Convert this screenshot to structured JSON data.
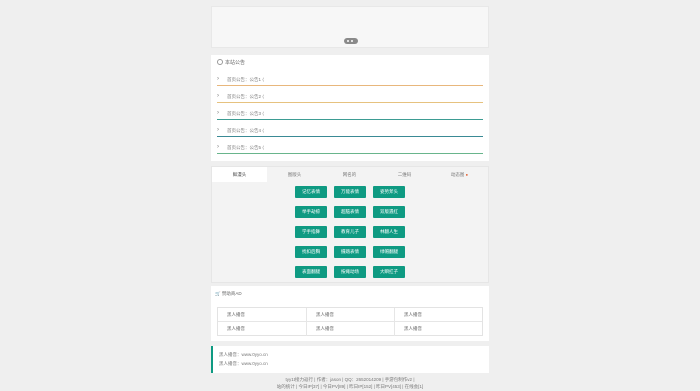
{
  "notice": {
    "title": "本站公告",
    "items": [
      {
        "text": "首页公告：公告1 ⟨",
        "color": "#e8b77c"
      },
      {
        "text": "首页公告：公告2 ⟨",
        "color": "#e6c27f"
      },
      {
        "text": "首页公告：公告3 ⟨",
        "color": "#3d9c93"
      },
      {
        "text": "首页公告：公告4 ⟨",
        "color": "#3a8a95"
      },
      {
        "text": "首页公告：公告5 ⟨",
        "color": "#69b58c"
      }
    ]
  },
  "tabs": [
    "鲜漫头",
    "图版头",
    "网名的",
    "二维码",
    "动态图"
  ],
  "tab_hot_mark": "●",
  "buttons": [
    [
      "记忆表情",
      "万能表情",
      "姿势斧头"
    ],
    [
      "举手劫掠",
      "超脑表情",
      "双版遇红"
    ],
    [
      "学手指舞",
      "教育儿子",
      "林翻人生"
    ],
    [
      "找扣后胸",
      "摄踏表情",
      "绿帽翻腿"
    ],
    [
      "表面翻腿",
      "按瘫动场",
      "大瞬扛子"
    ]
  ],
  "ads": {
    "title": "赞助商AD",
    "cells": [
      "黑人播音",
      "黑人播音",
      "黑人播音",
      "黑人播音",
      "黑人播音",
      "黑人播音"
    ]
  },
  "links": [
    "黑人播音：www.0yyo.cn",
    "黑人播音：www.0yyo.cn"
  ],
  "footer": [
    "tyy1t接力返行 | 作者：jason | QQ：2652014209 | 手游包制作v2 |",
    "站的统计 | 今日IP[37] | 今日PV[89] | 昨日IP[152] | 昨日PV[453] | 在线会[1]"
  ]
}
